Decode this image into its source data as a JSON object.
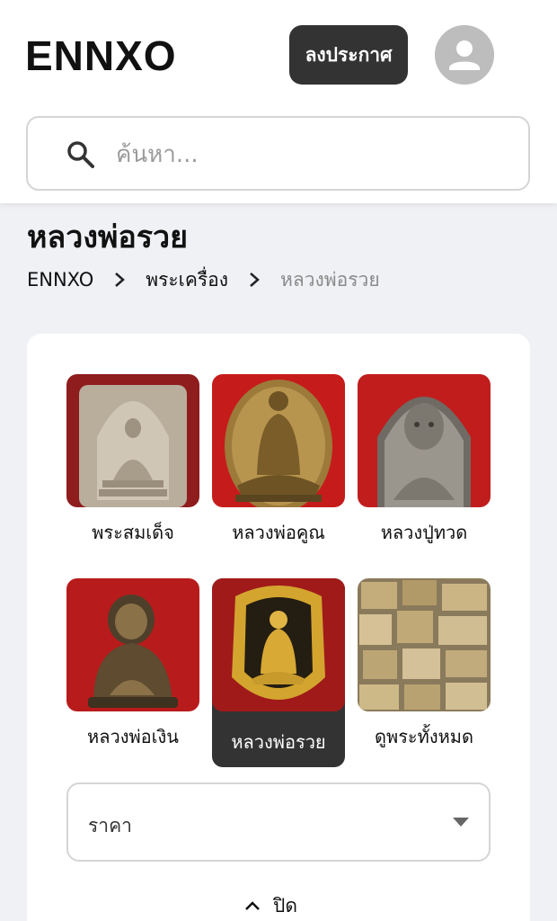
{
  "header": {
    "logo": "ENNXO",
    "post_button": "ลงประกาศ",
    "avatar_icon": "user-icon"
  },
  "search": {
    "placeholder": "ค้นหา...",
    "icon": "search-icon"
  },
  "page": {
    "title": "หลวงพ่อรวย"
  },
  "breadcrumb": [
    "ENNXO",
    "พระเครื่อง",
    "หลวงพ่อรวย"
  ],
  "categories": [
    {
      "label": "พระสมเด็จ",
      "selected": false
    },
    {
      "label": "หลวงพ่อคูณ",
      "selected": false
    },
    {
      "label": "หลวงปู่ทวด",
      "selected": false
    },
    {
      "label": "หลวงพ่อเงิน",
      "selected": false
    },
    {
      "label": "หลวงพ่อรวย",
      "selected": true
    },
    {
      "label": "ดูพระทั้งหมด",
      "selected": false
    }
  ],
  "filters": {
    "price_label": "ราคา"
  },
  "close_toggle": {
    "label": "ปิด",
    "icon": "chevron-up-icon"
  },
  "colors": {
    "accent_dark": "#333333",
    "amulet_background_red": "#b51d1d",
    "page_background": "#f0f1f4"
  }
}
